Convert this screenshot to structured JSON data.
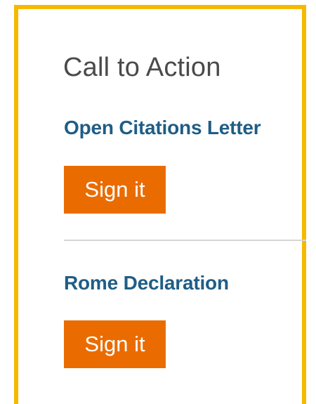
{
  "widget": {
    "title": "Call to Action",
    "items": [
      {
        "label": "Open Citations Letter",
        "button_label": "Sign it"
      },
      {
        "label": "Rome Declaration",
        "button_label": "Sign it"
      }
    ]
  },
  "colors": {
    "frame_border": "#f6b900",
    "button_background": "#ea6c00",
    "link_text": "#1f5d86",
    "title_text": "#4a4a4a",
    "divider": "#d6d6d6"
  }
}
